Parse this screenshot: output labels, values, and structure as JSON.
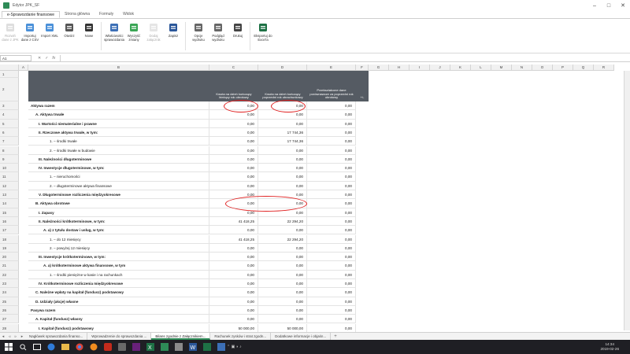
{
  "window": {
    "title": "Edytor JPK_SF"
  },
  "ribbon_tabs": [
    "e-Sprawozdanie finansowe",
    "Strona główna",
    "Formuły",
    "Widok"
  ],
  "ribbon_buttons": [
    {
      "label": "Rozwiń dane z JPK",
      "icon": "expand-data-icon",
      "disabled": true
    },
    {
      "label": "Importuj dane z CSV",
      "icon": "import-csv-icon",
      "disabled": false
    },
    {
      "label": "Import XML",
      "icon": "import-xml-icon",
      "disabled": false
    },
    {
      "label": "Otwórz",
      "icon": "open-icon",
      "disabled": false
    },
    {
      "label": "Nowe",
      "icon": "new-icon",
      "disabled": false
    },
    {
      "label": "Właściwości sprawozdania",
      "icon": "properties-icon",
      "disabled": false
    },
    {
      "label": "Wyczyść zmiany",
      "icon": "clear-changes-icon",
      "disabled": false
    },
    {
      "label": "Dodaj załącznik",
      "icon": "attachment-icon",
      "disabled": true
    },
    {
      "label": "Zapisz",
      "icon": "save-icon",
      "disabled": false
    },
    {
      "label": "Opcje wydruku",
      "icon": "print-options-icon",
      "disabled": false
    },
    {
      "label": "Podgląd wydruku",
      "icon": "print-preview-icon",
      "disabled": false
    },
    {
      "label": "Drukuj",
      "icon": "print-icon",
      "disabled": false
    },
    {
      "label": "Eksportuj do Excel'a",
      "icon": "excel-export-icon",
      "disabled": false
    }
  ],
  "formula_bar": {
    "name_box": "A1",
    "fx_label": "fx"
  },
  "columns": [
    "A",
    "B",
    "C",
    "D",
    "E",
    "F",
    "G",
    "H",
    "I",
    "J",
    "K",
    "L",
    "M",
    "N",
    "O",
    "P",
    "Q",
    "R"
  ],
  "header_row": {
    "c": "Kwota na dzień kończący bieżący rok obrotowy",
    "d": "Kwota na dzień kończący poprzedni rok obrachunkowy",
    "e": "Przekształcone dane porównawcze za poprzedni rok obrotowy",
    "f": "+/-"
  },
  "rows": [
    {
      "n": "1",
      "label": "",
      "c": "",
      "d": "",
      "e": ""
    },
    {
      "n": "2",
      "label": "",
      "c": "",
      "d": "",
      "e": ""
    },
    {
      "n": "3",
      "label": "Aktywa razem",
      "c": "0,00",
      "d": "0,00",
      "e": "0,00"
    },
    {
      "n": "4",
      "label": "A. Aktywa trwałe",
      "c": "0,00",
      "d": "0,00",
      "e": "0,00"
    },
    {
      "n": "5",
      "label": "I. Wartości niematerialne i prawne",
      "c": "0,00",
      "d": "0,00",
      "e": "0,00"
    },
    {
      "n": "6",
      "label": "II. Rzeczowe aktywa trwałe, w tym:",
      "c": "0,00",
      "d": "17 744,36",
      "e": "0,00"
    },
    {
      "n": "7",
      "label": "1. – środki trwałe",
      "c": "0,00",
      "d": "17 744,36",
      "e": "0,00"
    },
    {
      "n": "8",
      "label": "2. – środki trwałe w budowie",
      "c": "0,00",
      "d": "0,00",
      "e": "0,00"
    },
    {
      "n": "9",
      "label": "III. Należności długoterminowe",
      "c": "0,00",
      "d": "0,00",
      "e": "0,00"
    },
    {
      "n": "10",
      "label": "IV. Inwestycje długoterminowe, w tym:",
      "c": "0,00",
      "d": "0,00",
      "e": "0,00"
    },
    {
      "n": "11",
      "label": "1. – nieruchomości",
      "c": "0,00",
      "d": "0,00",
      "e": "0,00"
    },
    {
      "n": "12",
      "label": "2. – długoterminowe aktywa finansowe",
      "c": "0,00",
      "d": "0,00",
      "e": "0,00"
    },
    {
      "n": "13",
      "label": "V. Długoterminowe rozliczenia międzyokresowe",
      "c": "0,00",
      "d": "0,00",
      "e": "0,00"
    },
    {
      "n": "14",
      "label": "B. Aktywa obrotowe",
      "c": "0,00",
      "d": "0,00",
      "e": "0,00"
    },
    {
      "n": "15",
      "label": "I. Zapasy",
      "c": "0,00",
      "d": "0,00",
      "e": "0,00"
    },
    {
      "n": "16",
      "label": "II. Należności krótkoterminowe, w tym:",
      "c": "41 418,25",
      "d": "22 294,20",
      "e": "0,00"
    },
    {
      "n": "17",
      "label": "A. a) z tytułu dostaw i usług, w tym:",
      "c": "0,00",
      "d": "0,00",
      "e": "0,00"
    },
    {
      "n": "18",
      "label": "1. – do 12 miesięcy",
      "c": "41 418,25",
      "d": "22 294,20",
      "e": "0,00"
    },
    {
      "n": "19",
      "label": "2. – powyżej 12 miesięcy",
      "c": "0,00",
      "d": "0,00",
      "e": "0,00"
    },
    {
      "n": "20",
      "label": "III. Inwestycje krótkoterminowe, w tym:",
      "c": "0,00",
      "d": "0,00",
      "e": "0,00"
    },
    {
      "n": "21",
      "label": "A. a) krótkoterminowe aktywa finansowe, w tym",
      "c": "0,00",
      "d": "0,00",
      "e": "0,00"
    },
    {
      "n": "22",
      "label": "1. – środki pieniężne w kasie i na rachunkach",
      "c": "0,00",
      "d": "0,00",
      "e": "0,00"
    },
    {
      "n": "23",
      "label": "IV. Krótkoterminowe rozliczenia międzyokresowe",
      "c": "0,00",
      "d": "0,00",
      "e": "0,00"
    },
    {
      "n": "24",
      "label": "C. Należne wpłaty na kapitał (fundusz) podstawowy",
      "c": "0,00",
      "d": "0,00",
      "e": "0,00"
    },
    {
      "n": "25",
      "label": "D. Udziały (akcje) własne",
      "c": "0,00",
      "d": "0,00",
      "e": "0,00"
    },
    {
      "n": "26",
      "label": "Pasywa razem",
      "c": "0,00",
      "d": "0,00",
      "e": "0,00"
    },
    {
      "n": "27",
      "label": "A. Kapitał (fundusz) własny",
      "c": "0,00",
      "d": "0,00",
      "e": "0,00"
    },
    {
      "n": "28",
      "label": "I. Kapitał (fundusz) podstawowy",
      "c": "50 000,00",
      "d": "50 000,00",
      "e": "0,00"
    }
  ],
  "sheet_tabs": [
    {
      "label": "Nagłówek sprawozdania finanso...",
      "active": false
    },
    {
      "label": "Wprowadzenie do sprawozdania ...",
      "active": false
    },
    {
      "label": "Bilans zgodnie z Załącznikiem...",
      "active": true
    },
    {
      "label": "Rachunek zysków i strat zgodn...",
      "active": false
    },
    {
      "label": "Dodatkowe informacje i objaśn...",
      "active": false
    }
  ],
  "taskbar": {
    "time": "14:34",
    "date": "2019-02-26"
  },
  "colors": {
    "header_dark": "#555b63",
    "annotation": "#e02020",
    "accent": "#2e8b57"
  }
}
